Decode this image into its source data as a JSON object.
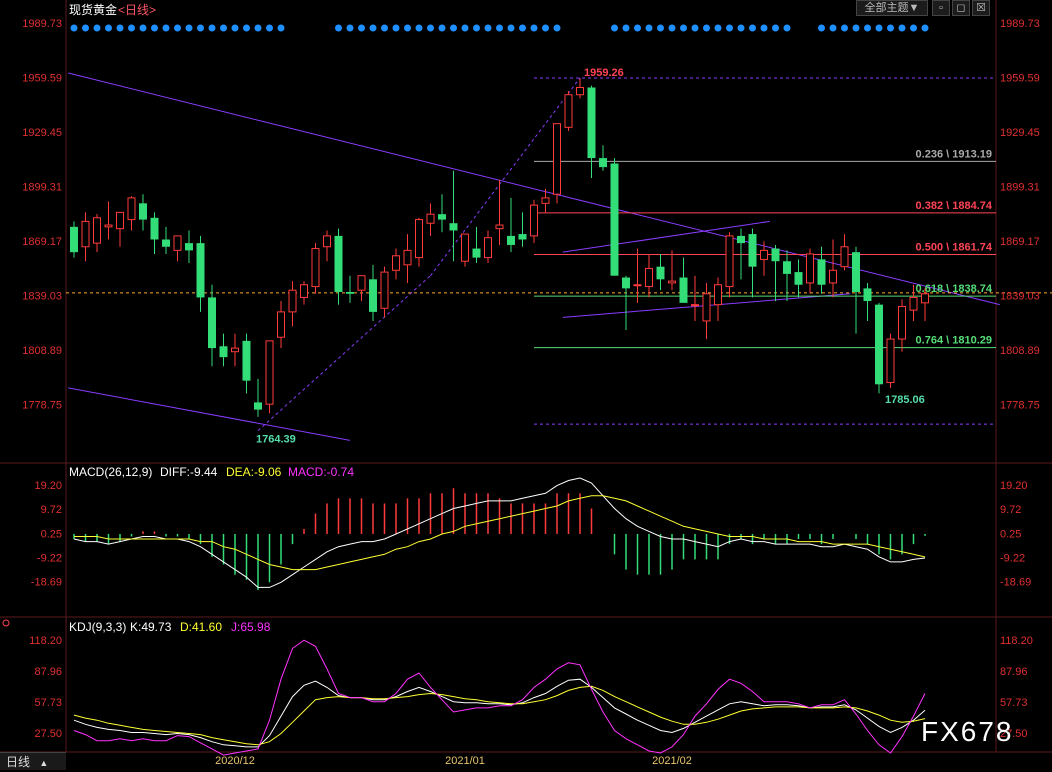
{
  "header": {
    "instrument": "现货黄金",
    "period_link": "<日线>",
    "theme_button": "全部主题",
    "theme_caret": "▼"
  },
  "window_controls": {
    "minimize": "▫",
    "restore": "◻",
    "close": "☒"
  },
  "period_tab": {
    "label": "日线",
    "caret": "▲"
  },
  "watermark": "FX678",
  "colors": {
    "up": "#ff3b3b",
    "down": "#33dd77",
    "trend": "#8a3cff",
    "fib_red": "#ff4455",
    "fib_green": "#55dd77",
    "fib_gray": "#aaaaaa",
    "dots": "#1e90ff",
    "diff": "#ffffff",
    "dea": "#ffff33",
    "kdj_j": "#ff33ff"
  },
  "chart_data": [
    {
      "type": "candlestick",
      "title": "现货黄金",
      "y_ticks": [
        "1989.73",
        "1959.59",
        "1929.45",
        "1899.31",
        "1869.17",
        "1839.03",
        "1808.89",
        "1778.75"
      ],
      "ylim": [
        1747.61,
        1992.4
      ],
      "x_labels": [
        {
          "index": 14,
          "label": "2020/12"
        },
        {
          "index": 34,
          "label": "2021/01"
        },
        {
          "index": 52,
          "label": "2021/02"
        }
      ],
      "candles": [
        [
          1877,
          1880,
          1860,
          1863
        ],
        [
          1866,
          1885,
          1858,
          1880
        ],
        [
          1868,
          1884,
          1863,
          1882
        ],
        [
          1877,
          1891,
          1870,
          1878
        ],
        [
          1876,
          1882,
          1866,
          1885
        ],
        [
          1881,
          1894,
          1875,
          1893
        ],
        [
          1890,
          1895,
          1875,
          1881
        ],
        [
          1882,
          1885,
          1862,
          1870
        ],
        [
          1870,
          1877,
          1862,
          1866
        ],
        [
          1864,
          1872,
          1858,
          1872
        ],
        [
          1868,
          1875,
          1857,
          1864
        ],
        [
          1868,
          1872,
          1830,
          1838
        ],
        [
          1838,
          1845,
          1800,
          1810
        ],
        [
          1811,
          1818,
          1800,
          1805
        ],
        [
          1808,
          1818,
          1800,
          1810
        ],
        [
          1814,
          1818,
          1785,
          1792
        ],
        [
          1780,
          1793,
          1772,
          1776
        ],
        [
          1779,
          1813,
          1774,
          1814
        ],
        [
          1816,
          1836,
          1810,
          1830
        ],
        [
          1830,
          1847,
          1822,
          1842
        ],
        [
          1838,
          1847,
          1834,
          1845
        ],
        [
          1844,
          1868,
          1840,
          1865
        ],
        [
          1866,
          1875,
          1858,
          1872
        ],
        [
          1872,
          1876,
          1834,
          1841
        ],
        [
          1841,
          1850,
          1835,
          1840
        ],
        [
          1842,
          1850,
          1836,
          1850
        ],
        [
          1848,
          1856,
          1825,
          1830
        ],
        [
          1832,
          1855,
          1827,
          1852
        ],
        [
          1853,
          1865,
          1848,
          1861
        ],
        [
          1856,
          1873,
          1846,
          1864
        ],
        [
          1860,
          1882,
          1855,
          1881
        ],
        [
          1879,
          1890,
          1872,
          1884
        ],
        [
          1884,
          1895,
          1874,
          1881
        ],
        [
          1879,
          1908,
          1858,
          1875
        ],
        [
          1858,
          1873,
          1855,
          1873
        ],
        [
          1865,
          1877,
          1857,
          1860
        ],
        [
          1860,
          1875,
          1857,
          1871
        ],
        [
          1876,
          1903,
          1867,
          1878
        ],
        [
          1872,
          1893,
          1863,
          1867
        ],
        [
          1873,
          1885,
          1866,
          1870
        ],
        [
          1872,
          1892,
          1868,
          1889
        ],
        [
          1890,
          1898,
          1885,
          1893
        ],
        [
          1895,
          1930,
          1890,
          1934
        ],
        [
          1932,
          1952,
          1930,
          1950
        ],
        [
          1950,
          1959,
          1948,
          1954
        ],
        [
          1954,
          1955,
          1904,
          1915
        ],
        [
          1915,
          1922,
          1908,
          1910
        ],
        [
          1912,
          1915,
          1850,
          1850
        ],
        [
          1849,
          1850,
          1820,
          1843
        ],
        [
          1845,
          1865,
          1835,
          1845
        ],
        [
          1844,
          1862,
          1838,
          1854
        ],
        [
          1855,
          1862,
          1842,
          1848
        ],
        [
          1846,
          1864,
          1842,
          1847
        ],
        [
          1849,
          1860,
          1840,
          1835
        ],
        [
          1834,
          1850,
          1825,
          1834
        ],
        [
          1825,
          1846,
          1815,
          1840
        ],
        [
          1834,
          1849,
          1825,
          1845
        ],
        [
          1844,
          1874,
          1838,
          1872
        ],
        [
          1872,
          1876,
          1848,
          1868
        ],
        [
          1873,
          1876,
          1838,
          1855
        ],
        [
          1859,
          1869,
          1850,
          1864
        ],
        [
          1865,
          1867,
          1836,
          1858
        ],
        [
          1858,
          1864,
          1836,
          1851
        ],
        [
          1852,
          1859,
          1838,
          1845
        ],
        [
          1846,
          1865,
          1840,
          1862
        ],
        [
          1859,
          1866,
          1840,
          1845
        ],
        [
          1846,
          1870,
          1838,
          1853
        ],
        [
          1855,
          1873,
          1853,
          1866
        ],
        [
          1863,
          1866,
          1818,
          1841
        ],
        [
          1843,
          1846,
          1825,
          1836
        ],
        [
          1834,
          1835,
          1785,
          1790
        ],
        [
          1791,
          1818,
          1788,
          1815
        ],
        [
          1815,
          1837,
          1808,
          1833
        ],
        [
          1831,
          1845,
          1825,
          1838
        ],
        [
          1835,
          1843,
          1825,
          1840
        ]
      ],
      "annotations": [
        {
          "label": "1959.26",
          "value": 1959.26
        },
        {
          "label": "1764.39",
          "value": 1764.39
        },
        {
          "label": "1785.06",
          "value": 1785.06
        }
      ],
      "fib_levels": [
        {
          "label": "0.236 \\ 1913.19",
          "value": 1913.19
        },
        {
          "label": "0.382 \\ 1884.74",
          "value": 1884.74
        },
        {
          "label": "0.500 \\ 1861.74",
          "value": 1861.74
        },
        {
          "label": "0.618 \\ 1838.74",
          "value": 1838.74
        },
        {
          "label": "0.764 \\ 1810.29",
          "value": 1810.29
        }
      ]
    },
    {
      "type": "line",
      "title": "MACD(26,12,9)",
      "legend": [
        {
          "label": "DIFF:-9.44"
        },
        {
          "label": "DEA:-9.06"
        },
        {
          "label": "MACD:-0.74"
        }
      ],
      "y_ticks": [
        "19.20",
        "9.72",
        "0.25",
        "-9.22",
        "-18.69"
      ],
      "ylim": [
        -24,
        22
      ],
      "diff": [
        -2,
        -3,
        -3,
        -4,
        -3,
        -2,
        -1,
        -1,
        -2,
        -2,
        -3,
        -5,
        -8,
        -11,
        -14,
        -17,
        -21,
        -21,
        -19,
        -16,
        -13,
        -10,
        -7,
        -5,
        -4,
        -3,
        -3,
        -2,
        0,
        2,
        4,
        6,
        8,
        10,
        11,
        12,
        13,
        13,
        13,
        14,
        15,
        16,
        19,
        21,
        22,
        20,
        15,
        10,
        6,
        3,
        1,
        -1,
        -2,
        -2,
        -3,
        -4,
        -5,
        -3,
        -2,
        -3,
        -3,
        -4,
        -4,
        -4,
        -4,
        -5,
        -5,
        -4,
        -5,
        -6,
        -9,
        -11,
        -11,
        -10,
        -9.44
      ],
      "dea": [
        -1,
        -1,
        -1,
        -2,
        -2,
        -2,
        -2,
        -2,
        -2,
        -2,
        -2,
        -3,
        -3,
        -5,
        -6,
        -8,
        -10,
        -12,
        -13,
        -14,
        -14,
        -14,
        -13,
        -12,
        -11,
        -10,
        -9,
        -8,
        -6,
        -5,
        -3,
        -2,
        0,
        1,
        3,
        4,
        5,
        6,
        7,
        8,
        9,
        10,
        11,
        13,
        14,
        15,
        15,
        14,
        13,
        11,
        9,
        7,
        5,
        3,
        2,
        1,
        0,
        -1,
        -1,
        -1,
        -2,
        -2,
        -2,
        -3,
        -3,
        -3,
        -4,
        -4,
        -4,
        -4,
        -5,
        -6,
        -7,
        -8,
        -9.06
      ],
      "macd": [
        -2,
        -3,
        -3,
        -4,
        -3,
        -1,
        1,
        1,
        -1,
        -1,
        -2,
        -4,
        -9,
        -12,
        -16,
        -18,
        -22,
        -19,
        -12,
        -4,
        2,
        8,
        12,
        14,
        14,
        14,
        12,
        12,
        12,
        14,
        14,
        16,
        16,
        18,
        16,
        16,
        16,
        14,
        12,
        12,
        12,
        12,
        16,
        16,
        16,
        10,
        0,
        -8,
        -14,
        -16,
        -16,
        -16,
        -14,
        -10,
        -10,
        -10,
        -10,
        -4,
        -2,
        -4,
        -2,
        -4,
        -4,
        -2,
        -2,
        -4,
        -2,
        0,
        -2,
        -4,
        -8,
        -10,
        -8,
        -4,
        -0.74
      ]
    },
    {
      "type": "line",
      "title": "KDJ(9,3,3)",
      "legend": [
        {
          "label": "K:49.73"
        },
        {
          "label": "D:41.60"
        },
        {
          "label": "J:65.98"
        }
      ],
      "y_ticks": [
        "118.20",
        "87.96",
        "57.73",
        "27.50"
      ],
      "ylim": [
        9,
        125
      ],
      "k": [
        40,
        36,
        33,
        31,
        30,
        28,
        28,
        27,
        26,
        27,
        26,
        23,
        19,
        16,
        15,
        14,
        14,
        25,
        44,
        63,
        74,
        78,
        72,
        64,
        62,
        62,
        60,
        60,
        63,
        68,
        72,
        68,
        63,
        58,
        57,
        57,
        56,
        56,
        55,
        57,
        62,
        66,
        73,
        79,
        80,
        72,
        62,
        52,
        46,
        40,
        35,
        30,
        28,
        32,
        38,
        44,
        50,
        56,
        58,
        56,
        54,
        55,
        55,
        54,
        52,
        53,
        53,
        55,
        50,
        42,
        34,
        28,
        33,
        40,
        49.73
      ],
      "d": [
        45,
        42,
        40,
        37,
        35,
        33,
        31,
        30,
        29,
        28,
        27,
        26,
        23,
        21,
        19,
        17,
        16,
        19,
        27,
        38,
        49,
        60,
        62,
        63,
        62,
        62,
        61,
        61,
        62,
        63,
        65,
        66,
        65,
        63,
        61,
        60,
        58,
        57,
        56,
        56,
        58,
        60,
        64,
        69,
        72,
        73,
        69,
        63,
        58,
        53,
        48,
        43,
        39,
        36,
        36,
        38,
        41,
        45,
        49,
        51,
        52,
        53,
        53,
        53,
        52,
        52,
        52,
        53,
        52,
        49,
        45,
        40,
        38,
        39,
        41.6
      ],
      "j": [
        30,
        26,
        20,
        20,
        22,
        20,
        22,
        20,
        20,
        25,
        24,
        18,
        12,
        6,
        8,
        10,
        12,
        40,
        80,
        110,
        118,
        112,
        90,
        66,
        62,
        62,
        58,
        58,
        66,
        80,
        86,
        72,
        60,
        48,
        50,
        52,
        52,
        54,
        54,
        60,
        72,
        80,
        90,
        96,
        94,
        70,
        48,
        30,
        22,
        16,
        10,
        8,
        14,
        26,
        44,
        56,
        70,
        80,
        76,
        68,
        58,
        58,
        58,
        56,
        52,
        55,
        55,
        60,
        46,
        30,
        16,
        8,
        24,
        44,
        65.98
      ]
    }
  ]
}
